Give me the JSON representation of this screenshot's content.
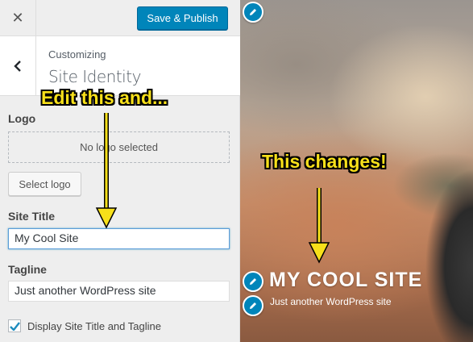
{
  "topbar": {
    "close_glyph": "✕",
    "save_label": "Save & Publish"
  },
  "section": {
    "eyebrow": "Customizing",
    "title": "Site Identity"
  },
  "logo": {
    "label": "Logo",
    "placeholder_text": "No logo selected",
    "select_label": "Select logo"
  },
  "site_title": {
    "label": "Site Title",
    "value": "My Cool Site"
  },
  "tagline": {
    "label": "Tagline",
    "value": "Just another WordPress site"
  },
  "display_toggle": {
    "label": "Display Site Title and Tagline",
    "checked": true
  },
  "preview": {
    "title": "MY COOL SITE",
    "tagline": "Just another WordPress site"
  },
  "annotations": {
    "left": "Edit this and...",
    "right": "This changes!"
  },
  "colors": {
    "accent": "#0085ba",
    "callout": "#f7e01a",
    "sidebar_bg": "#eeeeee"
  },
  "icons": [
    "close-icon",
    "back-chevron-icon",
    "checkmark-icon",
    "pencil-icon",
    "down-arrow-icon"
  ]
}
